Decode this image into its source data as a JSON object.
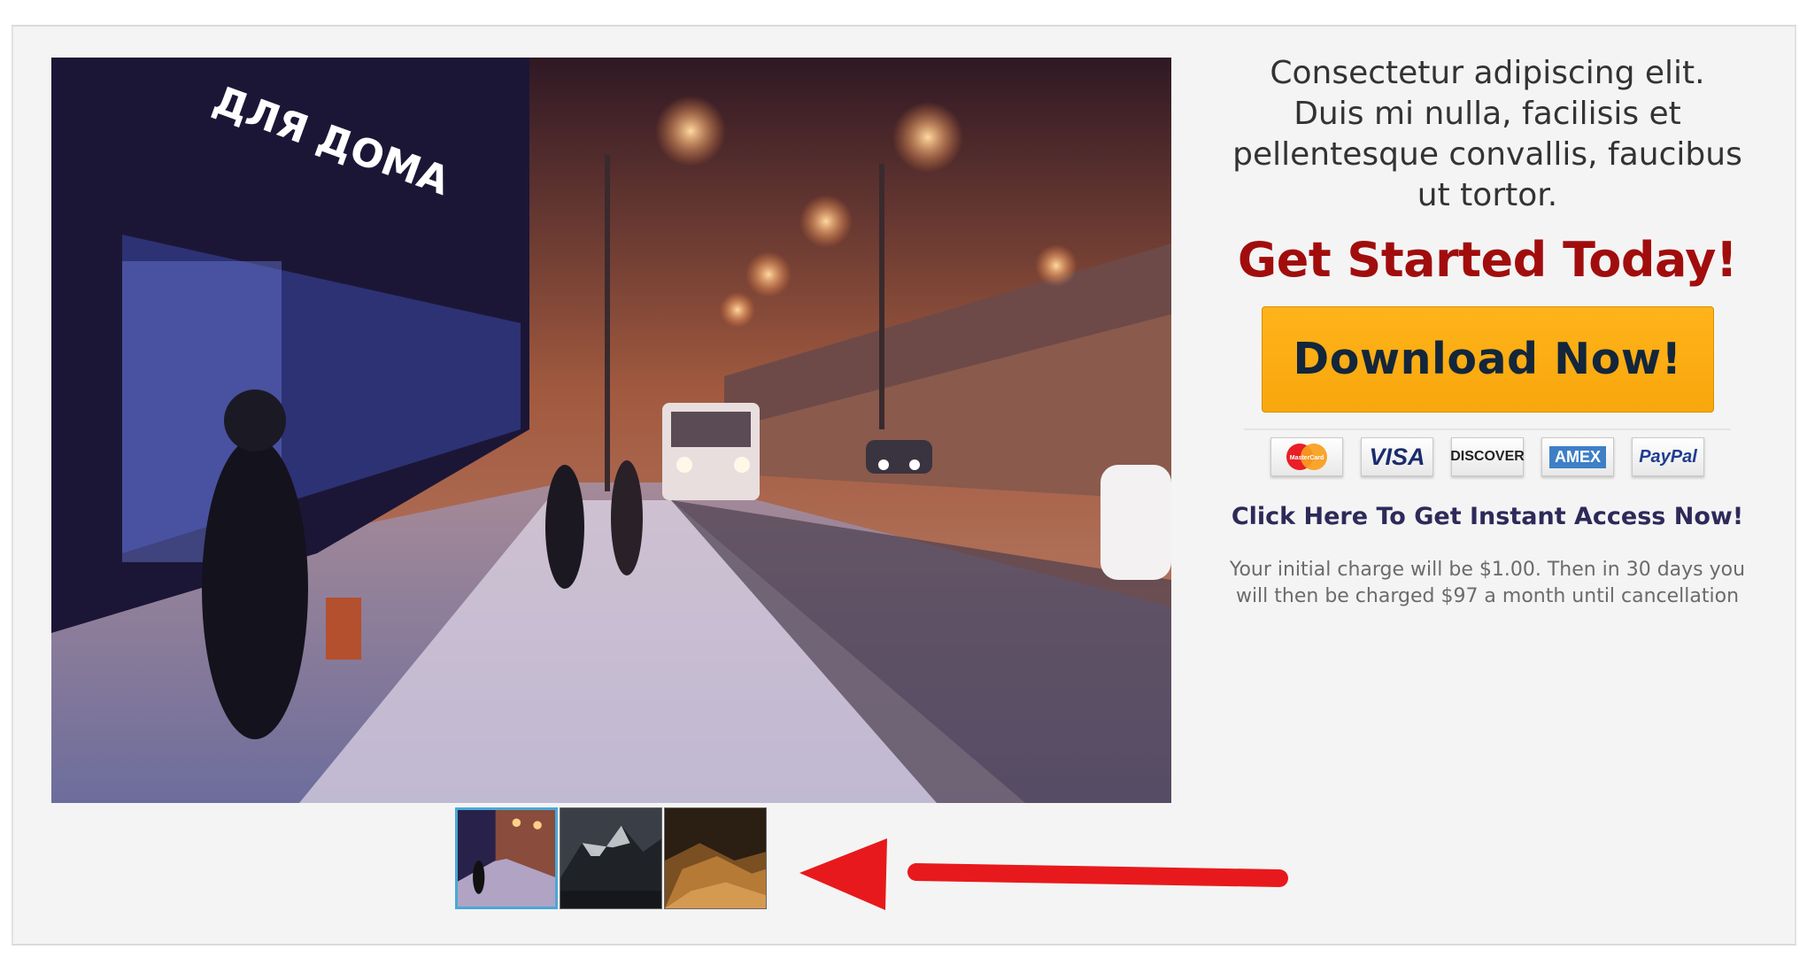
{
  "gallery": {
    "main_image_alt": "snowy city street at night",
    "thumbnails": [
      {
        "name": "thumb-snowy-street",
        "active": true
      },
      {
        "name": "thumb-mountains",
        "active": false
      },
      {
        "name": "thumb-desert-dunes",
        "active": false
      }
    ]
  },
  "offer": {
    "tagline": "Consectetur adipiscing elit. Duis mi nulla, facilisis et pellentesque convallis, faucibus ut tortor.",
    "headline": "Get Started Today!",
    "download_label": "Download Now!",
    "payment_cards": {
      "mastercard": "MasterCard",
      "visa": "VISA",
      "discover": "DISCOVER",
      "amex": "AMEX",
      "paypal": "PayPal"
    },
    "access_link": "Click Here To Get Instant Access Now!",
    "charge_note": "Your initial charge will be $1.00. Then in 30 days you will then be charged $97 a month until cancellation"
  },
  "colors": {
    "headline": "#a10d0d",
    "button_bg": "#f8a70c",
    "button_text": "#13263b",
    "link": "#2d2a5a",
    "arrow": "#e8191c",
    "thumb_active_border": "#4aa8d8"
  }
}
